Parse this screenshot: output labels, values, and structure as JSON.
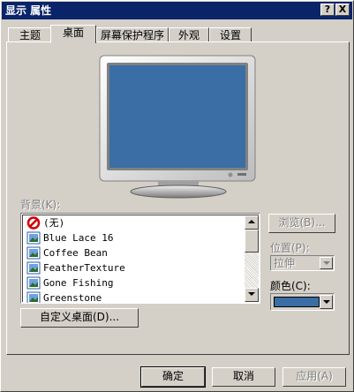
{
  "window": {
    "title": "显示 属性",
    "help_label": "?",
    "close_label": "X"
  },
  "tabs": [
    {
      "label": "主题"
    },
    {
      "label": "桌面"
    },
    {
      "label": "屏幕保护程序"
    },
    {
      "label": "外观"
    },
    {
      "label": "设置"
    }
  ],
  "active_tab": "桌面",
  "monitor": {
    "screen_color": "#3a6ea5"
  },
  "background": {
    "label": "背景(K):",
    "items": [
      {
        "label": "(无)",
        "icon": "none-icon"
      },
      {
        "label": "Blue Lace 16",
        "icon": "image-file-icon"
      },
      {
        "label": "Coffee Bean",
        "icon": "image-file-icon"
      },
      {
        "label": "FeatherTexture",
        "icon": "image-file-icon"
      },
      {
        "label": "Gone Fishing",
        "icon": "image-file-icon"
      },
      {
        "label": "Greenstone",
        "icon": "image-file-icon"
      }
    ]
  },
  "browse_label": "浏览(B)...",
  "position": {
    "label": "位置(P):",
    "value": "拉伸"
  },
  "color": {
    "label": "颜色(C):",
    "value": "#3a6ea5"
  },
  "customize_label": "自定义桌面(D)...",
  "footer": {
    "ok": "确定",
    "cancel": "取消",
    "apply": "应用(A)"
  }
}
